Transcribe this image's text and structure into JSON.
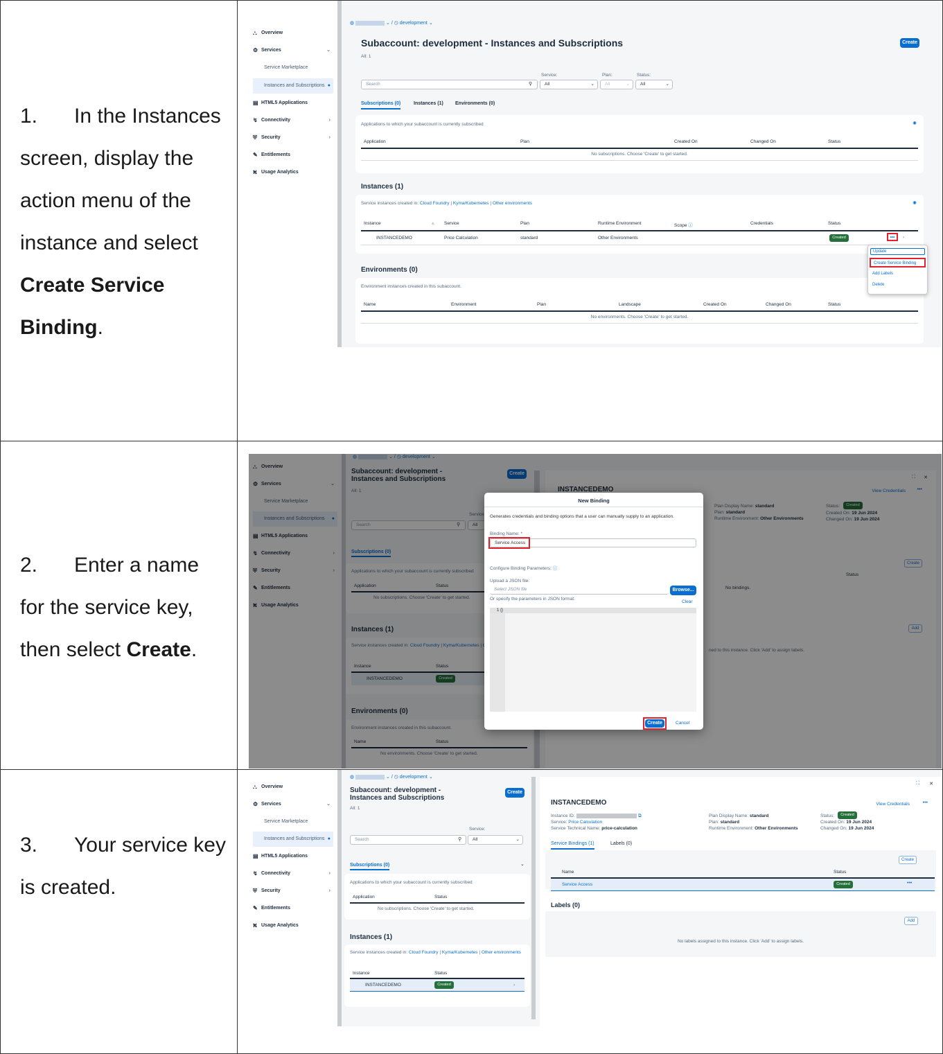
{
  "steps": [
    {
      "num": "1.",
      "text": "In the Instances screen, display the action menu of the instance and select ",
      "bold": "Create Service Binding",
      "end": "."
    },
    {
      "num": "2.",
      "text": "Enter a name for the service key, then select ",
      "bold": "Create",
      "end": "."
    },
    {
      "num": "3.",
      "text": "Your service key is created.",
      "bold": "",
      "end": ""
    }
  ],
  "nav": {
    "overview": "Overview",
    "services": "Services",
    "marketplace": "Service Marketplace",
    "instances": "Instances and Subscriptions",
    "html5": "HTML5 Applications",
    "connectivity": "Connectivity",
    "security": "Security",
    "entitlements": "Entitlements",
    "usage": "Usage Analytics"
  },
  "crumb": {
    "env": "development"
  },
  "page": {
    "title": "Subaccount: development - Instances and Subscriptions",
    "title_l1": "Subaccount: development -",
    "title_l2": "Instances and Subscriptions",
    "count": "All: 1",
    "create": "Create",
    "search": "Search",
    "service_lbl": "Service:",
    "plan_lbl": "Plan:",
    "status_lbl": "Status:",
    "all": "All"
  },
  "tabs": {
    "subs": "Subscriptions (0)",
    "inst": "Instances (1)",
    "envs": "Environments (0)"
  },
  "subs": {
    "desc": "Applications to which your subaccount is currently subscribed",
    "cols": [
      "Application",
      "Plan",
      "Created On",
      "Changed On",
      "Status"
    ],
    "empty": "No subscriptions. Choose 'Create' to get started."
  },
  "instances": {
    "title": "Instances (1)",
    "desc_prefix": "Service instances created in: ",
    "cf": "Cloud Foundry",
    "kyma": "Kyma/Kubernetes",
    "other": "Other environments",
    "cols": [
      "Instance",
      "Service",
      "Plan",
      "Runtime Environment",
      "Scope",
      "Credentials",
      "Status"
    ],
    "row": {
      "name": "INSTANCEDEMO",
      "service": "Price Calculation",
      "plan": "standard",
      "runtime": "Other Environments",
      "status": "Created"
    }
  },
  "menu": {
    "update": "Update",
    "create_binding": "Create Service Binding",
    "add_labels": "Add Labels",
    "delete": "Delete"
  },
  "envs": {
    "title": "Environments (0)",
    "desc": "Environment instances created in this subaccount.",
    "cols": [
      "Name",
      "Environment",
      "Plan",
      "Landscape",
      "Created On",
      "Changed On",
      "Status"
    ],
    "empty": "No environments. Choose 'Create' to get started."
  },
  "detail": {
    "title": "INSTANCEDEMO",
    "view_creds": "View Credentials",
    "instance_id": "Instance ID:",
    "service": "Service:",
    "service_val": "Price Calculation",
    "tech_name": "Service Technical Name:",
    "tech_val": "price-calculation",
    "plan_disp": "Plan Display Name:",
    "plan_disp_val": "standard",
    "plan": "Plan:",
    "plan_val": "standard",
    "runtime": "Runtime Environment:",
    "runtime_val": "Other Environments",
    "status": "Status:",
    "status_val": "Created",
    "created_on": "Created On:",
    "changed_on": "Changed On:",
    "date": "19 Jun 2024",
    "tab_bindings": "Service Bindings (1)",
    "tab_labels": "Labels (0)",
    "create": "Create",
    "add": "Add",
    "name": "Name",
    "status_col": "Status",
    "binding_name": "Service Access",
    "no_bindings": "No bindings.",
    "labels_title": "Labels (0)",
    "no_labels": "No labels assigned to this instance. Click 'Add' to assign labels.",
    "no_labels_partial": "ned to this instance. Click 'Add' to assign labels."
  },
  "dialog": {
    "title": "New Binding",
    "desc": "Generates credentials and binding options that a user can manually supply to an application.",
    "name_lbl": "Binding Name: *",
    "name_val": "Service Access",
    "params": "Configure Binding Parameters:",
    "upload": "Upload a JSON file:",
    "select": "Select JSON file",
    "browse": "Browse...",
    "or": "Or specify the parameters in JSON format:",
    "clear": "Clear",
    "code": "1   {}",
    "create": "Create",
    "cancel": "Cancel"
  },
  "colors": {
    "accent": "#0a6ed1",
    "success": "#256f3a",
    "highlight": "#e0222f"
  }
}
